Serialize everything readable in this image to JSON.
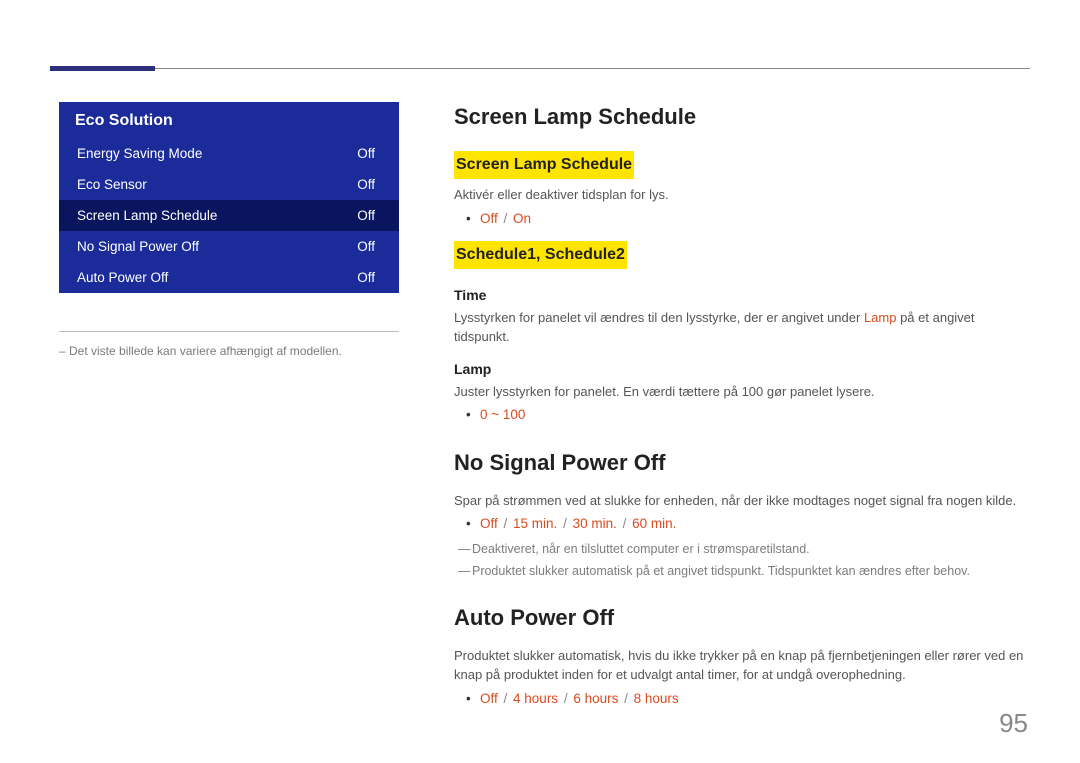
{
  "page_number": "95",
  "menu": {
    "title": "Eco Solution",
    "rows": [
      {
        "label": "Energy Saving Mode",
        "value": "Off",
        "selected": false
      },
      {
        "label": "Eco Sensor",
        "value": "Off",
        "selected": false
      },
      {
        "label": "Screen Lamp Schedule",
        "value": "Off",
        "selected": true
      },
      {
        "label": "No Signal Power Off",
        "value": "Off",
        "selected": false
      },
      {
        "label": "Auto Power Off",
        "value": "Off",
        "selected": false
      }
    ]
  },
  "footnote": "–  Det viste billede kan variere afhængigt af modellen.",
  "s1": {
    "title": "Screen Lamp Schedule",
    "sub1": "Screen Lamp Schedule",
    "sub1_desc": "Aktivér eller deaktiver tidsplan for lys.",
    "sub1_opts": [
      "Off",
      "On"
    ],
    "sub2": "Schedule1, Schedule2",
    "time_h": "Time",
    "time_desc_a": "Lysstyrken for panelet vil ændres til den lysstyrke, der er angivet under ",
    "time_desc_hl": "Lamp",
    "time_desc_b": " på et angivet tidspunkt.",
    "lamp_h": "Lamp",
    "lamp_desc": "Juster lysstyrken for panelet. En værdi tættere på 100 gør panelet lysere.",
    "lamp_range": "0 ~ 100"
  },
  "s2": {
    "title": "No Signal Power Off",
    "desc": "Spar på strømmen ved at slukke for enheden, når der ikke modtages noget signal fra nogen kilde.",
    "opts": [
      "Off",
      "15 min.",
      "30 min.",
      "60 min."
    ],
    "note1": "Deaktiveret, når en tilsluttet computer er i strømsparetilstand.",
    "note2": "Produktet slukker automatisk på et angivet tidspunkt. Tidspunktet kan ændres efter behov."
  },
  "s3": {
    "title": "Auto Power Off",
    "desc": "Produktet slukker automatisk, hvis du ikke trykker på en knap på fjernbetjeningen eller rører ved en knap på produktet inden for et udvalgt antal timer, for at undgå overophedning.",
    "opts": [
      "Off",
      "4 hours",
      "6 hours",
      "8 hours"
    ]
  }
}
